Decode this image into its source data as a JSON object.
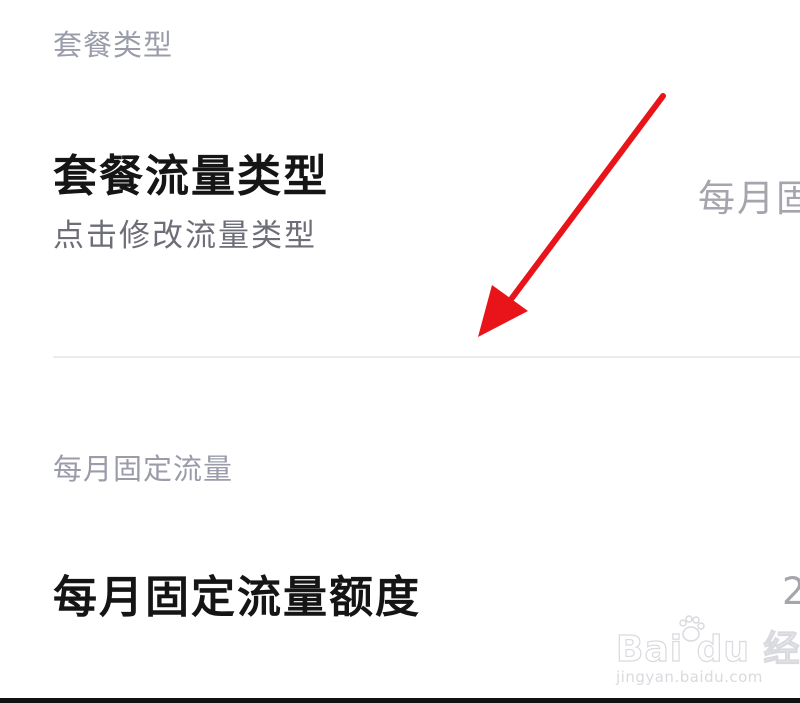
{
  "sections": {
    "plan_type": {
      "header": "套餐类型",
      "row": {
        "title": "套餐流量类型",
        "subtitle": "点击修改流量类型",
        "value": "每月固"
      }
    },
    "fixed_data": {
      "header": "每月固定流量",
      "row": {
        "title": "每月固定流量额度",
        "value": "2"
      }
    }
  },
  "watermark": {
    "brand": "Bai du 经验",
    "url": "jingyan.baidu.com"
  },
  "colors": {
    "annotation_arrow": "#e8141a",
    "section_header": "#9a9caa",
    "title": "#151515",
    "subtitle": "#6e6e78",
    "value": "#a5a5ad",
    "divider": "#ececf0"
  }
}
